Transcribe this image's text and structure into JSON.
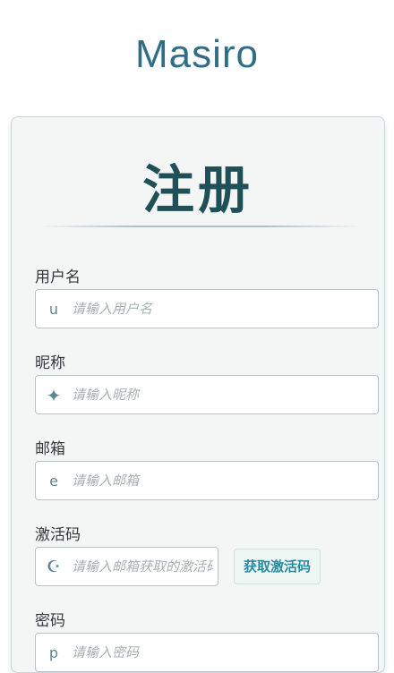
{
  "app": {
    "title": "Masiro"
  },
  "form": {
    "title": "注册",
    "fields": {
      "username": {
        "label": "用户名",
        "placeholder": "请输入用户名",
        "icon": "u",
        "icon_name": "user-icon"
      },
      "nickname": {
        "label": "昵称",
        "placeholder": "请输入昵称",
        "icon": "✦",
        "icon_name": "star-icon"
      },
      "email": {
        "label": "邮箱",
        "placeholder": "请输入邮箱",
        "icon": "e",
        "icon_name": "email-icon"
      },
      "activation": {
        "label": "激活码",
        "placeholder": "请输入邮箱获取的激活码",
        "icon": "☪",
        "icon_name": "moon-icon",
        "button_label": "获取激活码"
      },
      "password": {
        "label": "密码",
        "placeholder": "请输入密码",
        "icon": "p",
        "icon_name": "password-icon"
      }
    }
  },
  "colors": {
    "accent": "#2f6e86",
    "title": "#1f4f57",
    "button_text": "#2a8aa0"
  }
}
